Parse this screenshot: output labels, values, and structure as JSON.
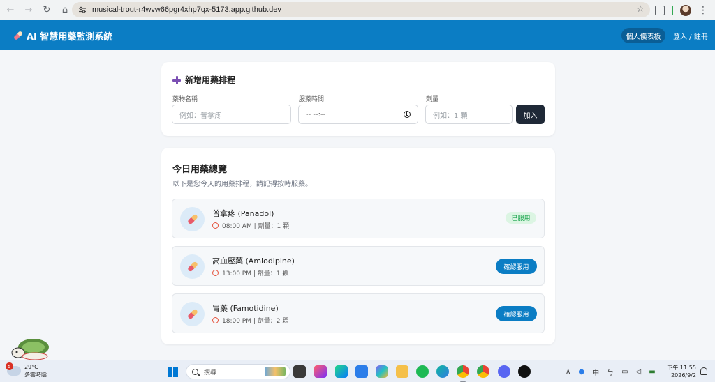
{
  "browser": {
    "url": "musical-trout-r4wvw66pgr4xhp7qx-5173.app.github.dev"
  },
  "app": {
    "title": "AI 智慧用藥監測系統",
    "dashboard_button": "個人儀表板",
    "login_link": "登入 / 註冊"
  },
  "add_form": {
    "title": "新增用藥排程",
    "name_label": "藥物名稱",
    "name_placeholder": "例如：普拿疼",
    "time_label": "服藥時間",
    "time_placeholder": "-- --:--",
    "dose_label": "劑量",
    "dose_placeholder": "例如：1 顆",
    "submit_label": "加入"
  },
  "today": {
    "title": "今日用藥總覽",
    "subtitle": "以下是您今天的用藥排程，請記得按時服藥。",
    "items": [
      {
        "name": "普拿疼 (Panadol)",
        "meta": "08:00 AM | 劑量：1 顆",
        "status": "taken",
        "status_label": "已服用"
      },
      {
        "name": "高血壓藥 (Amlodipine)",
        "meta": "13:00 PM | 劑量：1 顆",
        "status": "pending",
        "status_label": "確認服用"
      },
      {
        "name": "胃藥 (Famotidine)",
        "meta": "18:00 PM | 劑量：2 顆",
        "status": "pending",
        "status_label": "確認服用"
      }
    ]
  },
  "taskbar": {
    "weather_temp": "29°C",
    "weather_desc": "多雲時陰",
    "weather_badge": "5",
    "search_placeholder": "搜尋",
    "ime_label": "中",
    "clock_time": "下午 11:55",
    "clock_date": "2026/9/2"
  },
  "colors": {
    "header_bg": "#0b7dc4",
    "primary_button": "#0b7dc4",
    "add_button": "#1f2937",
    "taken_badge_bg": "#dcf5e3",
    "taken_badge_text": "#16a34a",
    "plus_icon": "#7b4fb3"
  }
}
